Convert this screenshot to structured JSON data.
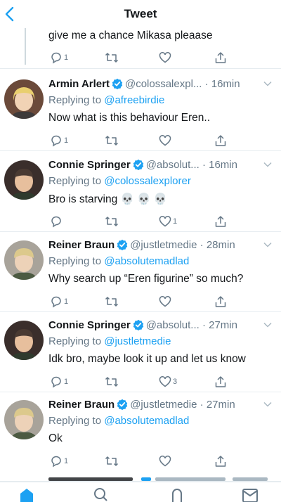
{
  "header": {
    "title": "Tweet"
  },
  "parent": {
    "text": "give me a chance Mikasa pleaase",
    "replies": "1",
    "retweets": "",
    "likes": ""
  },
  "tweets": [
    {
      "name": "Armin Arlert",
      "handle": "@colossalexpl...",
      "time": "· 16min",
      "replying_prefix": "Replying to ",
      "replying_to": "@afreebirdie",
      "text": "Now what is this behaviour Eren..",
      "replies": "1",
      "likes": ""
    },
    {
      "name": "Connie Springer",
      "handle": "@absolut...",
      "time": "· 16min",
      "replying_prefix": "Replying to ",
      "replying_to": "@colossalexplorer",
      "text": "Bro is starving 💀 💀 💀",
      "replies": "",
      "likes": "1"
    },
    {
      "name": "Reiner Braun",
      "handle": "@justletmedie",
      "time": "· 28min",
      "replying_prefix": "Replying to ",
      "replying_to": "@absolutemadlad",
      "text": "Why search up “Eren figurine” so much?",
      "replies": "1",
      "likes": ""
    },
    {
      "name": "Connie Springer",
      "handle": "@absolut...",
      "time": "· 27min",
      "replying_prefix": "Replying to ",
      "replying_to": "@justletmedie",
      "text": "Idk bro, maybe look it up and let us know",
      "replies": "1",
      "likes": "3"
    },
    {
      "name": "Reiner Braun",
      "handle": "@justletmedie",
      "time": "· 27min",
      "replying_prefix": "Replying to ",
      "replying_to": "@absolutemadlad",
      "text": "Ok",
      "replies": "1",
      "likes": ""
    }
  ],
  "colors": {
    "link": "#1da1f2",
    "muted": "#657786",
    "text": "#14171a",
    "verified": "#1da1f2"
  },
  "icons": {
    "back": "chevron-left-icon",
    "reply": "reply-icon",
    "retweet": "retweet-icon",
    "like": "heart-icon",
    "share": "share-icon",
    "tabs": [
      "home-icon",
      "search-icon",
      "notifications-icon",
      "messages-icon"
    ]
  }
}
